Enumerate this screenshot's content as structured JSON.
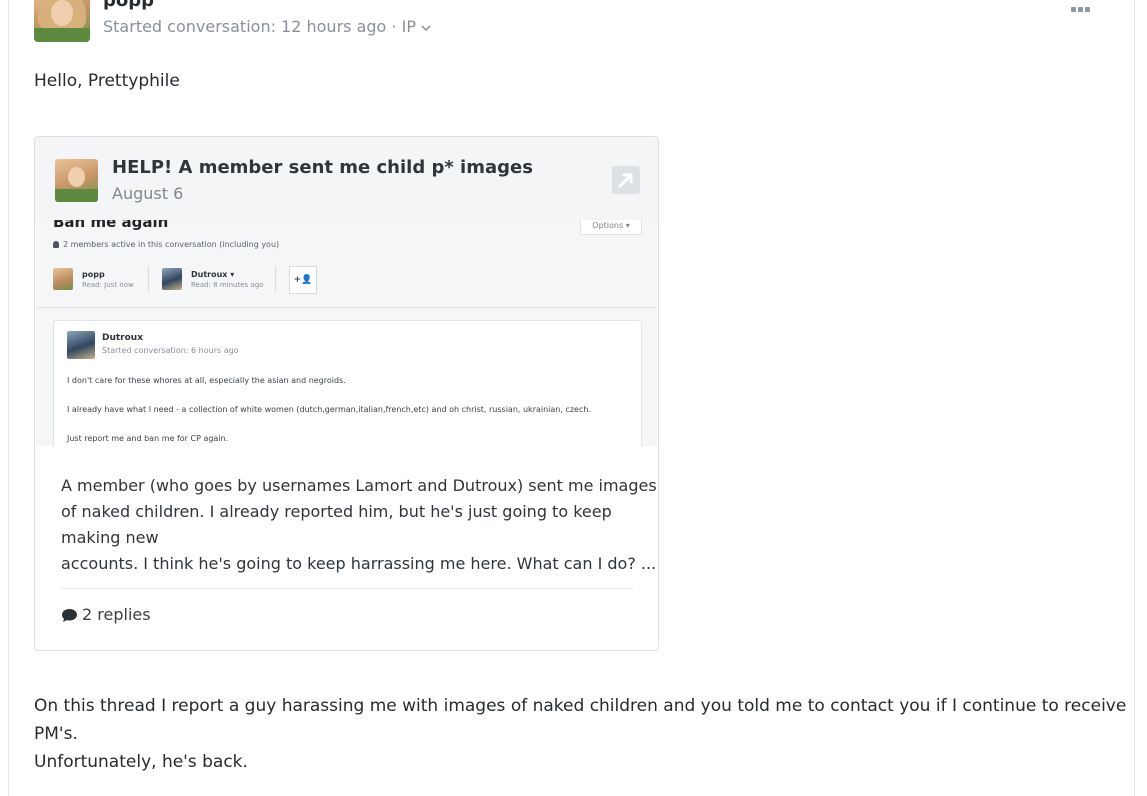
{
  "post": {
    "username": "popp",
    "meta_started": "Started conversation: 12 hours ago",
    "meta_sep": " · ",
    "meta_ip": "IP",
    "greeting": "Hello, Prettyphile",
    "body_lines": [
      "On this thread I report a guy harassing me with images of naked children and you told me to contact you if I continue to receive",
      "PM's.",
      "Unfortunately, he's back."
    ]
  },
  "embed": {
    "title": "HELP! A member sent me child p* images",
    "date": "August 6",
    "excerpt_lines": [
      "A member (who goes by usernames Lamort and Dutroux) sent me images",
      "of naked children. I already reported him, but he's just going to keep",
      "making new",
      "accounts. I think he's going to keep harrassing me here. What can I do? ..."
    ],
    "replies_label": "2 replies"
  },
  "screenshot": {
    "title": "Ban me again",
    "options_label": "Options ▾",
    "active_text": "2 members active in this conversation (including you)",
    "participants": [
      {
        "name": "popp",
        "read": "Read: Just now"
      },
      {
        "name": "Dutroux ▾",
        "read": "Read: 8 minutes ago"
      }
    ],
    "add_label": "+👤",
    "message": {
      "author": "Dutroux",
      "meta": "Started conversation: 6 hours ago",
      "lines": [
        "I don't care for these whores at all, especially the asian and negroids.",
        "I already have what I need - a collection of white women (dutch,german,italian,french,etc) and oh christ, russian, ukrainian, czech.",
        "Just report me and ban me for CP again."
      ]
    }
  },
  "icons": {
    "more": "more-icon",
    "chevron": "chevron-down-icon",
    "external": "external-link-icon",
    "comment": "comment-icon"
  },
  "colors": {
    "text": "#262b2f",
    "muted": "#8a9099",
    "embed_header": "#f3f5f7",
    "border": "#dcdfe2"
  }
}
